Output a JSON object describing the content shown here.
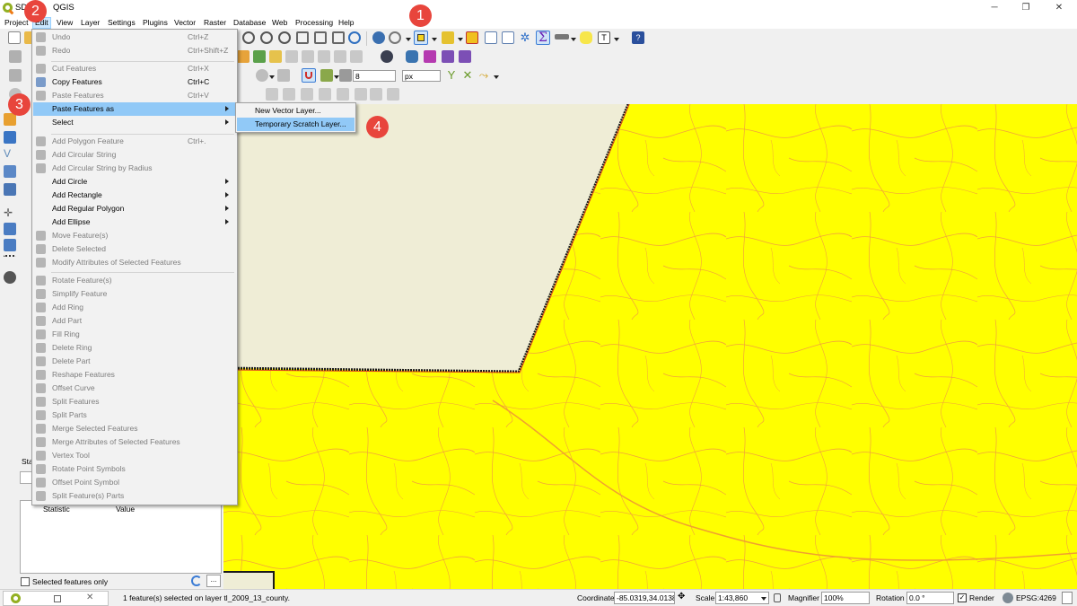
{
  "window": {
    "title_prefix": "SD",
    "title_app": "QGIS",
    "minimize_glyph": "─",
    "maximize_glyph": "❐",
    "close_glyph": "✕"
  },
  "menubar": [
    {
      "label": "Project"
    },
    {
      "label": "Edit"
    },
    {
      "label": "View"
    },
    {
      "label": "Layer"
    },
    {
      "label": "Settings"
    },
    {
      "label": "Plugins"
    },
    {
      "label": "Vector"
    },
    {
      "label": "Raster"
    },
    {
      "label": "Database"
    },
    {
      "label": "Web"
    },
    {
      "label": "Processing"
    },
    {
      "label": "Help"
    }
  ],
  "edit_menu": {
    "items": [
      {
        "label": "Undo",
        "shortcut": "Ctrl+Z",
        "disabled": true
      },
      {
        "label": "Redo",
        "shortcut": "Ctrl+Shift+Z",
        "disabled": true
      },
      {
        "label": "Cut Features",
        "shortcut": "Ctrl+X",
        "disabled": true
      },
      {
        "label": "Copy Features",
        "shortcut": "Ctrl+C",
        "disabled": false
      },
      {
        "label": "Paste Features",
        "shortcut": "Ctrl+V",
        "disabled": true
      },
      {
        "label": "Paste Features as",
        "shortcut": "",
        "disabled": false,
        "submenu": true,
        "highlighted": true
      },
      {
        "label": "Select",
        "shortcut": "",
        "disabled": false,
        "submenu": true
      },
      {
        "label": "Add Polygon Feature",
        "shortcut": "Ctrl+.",
        "disabled": true
      },
      {
        "label": "Add Circular String",
        "shortcut": "",
        "disabled": true
      },
      {
        "label": "Add Circular String by Radius",
        "shortcut": "",
        "disabled": true
      },
      {
        "label": "Add Circle",
        "shortcut": "",
        "disabled": false,
        "submenu": true
      },
      {
        "label": "Add Rectangle",
        "shortcut": "",
        "disabled": false,
        "submenu": true
      },
      {
        "label": "Add Regular Polygon",
        "shortcut": "",
        "disabled": false,
        "submenu": true
      },
      {
        "label": "Add Ellipse",
        "shortcut": "",
        "disabled": false,
        "submenu": true
      },
      {
        "label": "Move Feature(s)",
        "shortcut": "",
        "disabled": true
      },
      {
        "label": "Delete Selected",
        "shortcut": "",
        "disabled": true
      },
      {
        "label": "Modify Attributes of Selected Features",
        "shortcut": "",
        "disabled": true
      },
      {
        "label": "Rotate Feature(s)",
        "shortcut": "",
        "disabled": true
      },
      {
        "label": "Simplify Feature",
        "shortcut": "",
        "disabled": true
      },
      {
        "label": "Add Ring",
        "shortcut": "",
        "disabled": true
      },
      {
        "label": "Add Part",
        "shortcut": "",
        "disabled": true
      },
      {
        "label": "Fill Ring",
        "shortcut": "",
        "disabled": true
      },
      {
        "label": "Delete Ring",
        "shortcut": "",
        "disabled": true
      },
      {
        "label": "Delete Part",
        "shortcut": "",
        "disabled": true
      },
      {
        "label": "Reshape Features",
        "shortcut": "",
        "disabled": true
      },
      {
        "label": "Offset Curve",
        "shortcut": "",
        "disabled": true
      },
      {
        "label": "Split Features",
        "shortcut": "",
        "disabled": true
      },
      {
        "label": "Split Parts",
        "shortcut": "",
        "disabled": true
      },
      {
        "label": "Merge Selected Features",
        "shortcut": "",
        "disabled": true
      },
      {
        "label": "Merge Attributes of Selected Features",
        "shortcut": "",
        "disabled": true
      },
      {
        "label": "Vertex Tool",
        "shortcut": "",
        "disabled": true
      },
      {
        "label": "Rotate Point Symbols",
        "shortcut": "",
        "disabled": true
      },
      {
        "label": "Offset Point Symbol",
        "shortcut": "",
        "disabled": true
      },
      {
        "label": "Split Feature(s) Parts",
        "shortcut": "",
        "disabled": true
      }
    ]
  },
  "paste_as_submenu": {
    "items": [
      {
        "label": "New Vector Layer...",
        "highlighted": false
      },
      {
        "label": "Temporary Scratch Layer...",
        "highlighted": true
      }
    ]
  },
  "callouts": [
    {
      "number": "1",
      "target": "select-features-tool"
    },
    {
      "number": "2",
      "target": "edit-menu"
    },
    {
      "number": "3",
      "target": "paste-features-as"
    },
    {
      "number": "4",
      "target": "temporary-scratch-layer"
    }
  ],
  "toolbar": {
    "snapping_tolerance": "8",
    "snapping_unit": "px"
  },
  "stats_panel": {
    "tab_label": "Sta",
    "col_statistic": "Statistic",
    "col_value": "Value",
    "selected_only_label": "Selected features only"
  },
  "statusbar": {
    "message": "1 feature(s) selected on layer tl_2009_13_county.",
    "coordinate_label": "Coordinate",
    "coordinate_value": "-85.0319,34.0138",
    "scale_label": "Scale",
    "scale_value": "1:43,860",
    "magnifier_label": "Magnifier",
    "magnifier_value": "100%",
    "rotation_label": "Rotation",
    "rotation_value": "0.0 °",
    "render_label": "Render",
    "crs": "EPSG:4269"
  },
  "colors": {
    "map_fill": "#ffff00",
    "road_lines": "#f2a23a",
    "unselected_county": "#efedd6",
    "highlight": "#91c9f7",
    "callout": "#e8453c"
  }
}
